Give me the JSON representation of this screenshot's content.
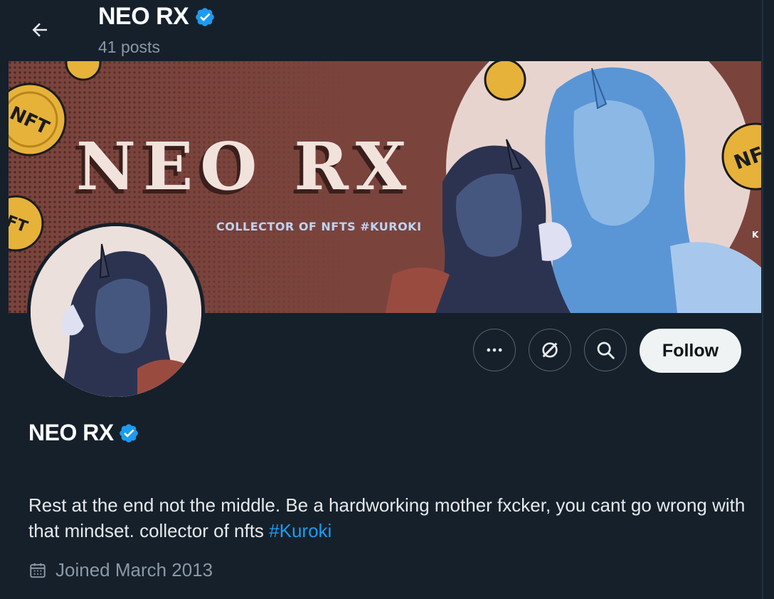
{
  "header": {
    "back_icon": "arrow-left-icon",
    "name": "NEO RX",
    "posts": "41 posts"
  },
  "banner": {
    "title": "NEO RX",
    "subtitle": "COLLECTOR OF NFTS #KUROKI",
    "coin_text": "NFT",
    "coin_text_partial": "FT",
    "coin_text_right": "NF",
    "fan_letter": "K"
  },
  "actions": {
    "more_icon": "more-dots-icon",
    "subscribe_icon": "subscribe-slash-icon",
    "search_icon": "search-icon",
    "follow_label": "Follow"
  },
  "profile": {
    "name": "NEO RX",
    "bio_text": "Rest at the end not the middle. Be a hardworking mother fxcker, you cant go wrong with that mindset. collector of nfts ",
    "bio_hashtag": "#Kuroki",
    "joined": "Joined March 2013",
    "joined_icon": "calendar-icon"
  },
  "colors": {
    "background": "#15202b",
    "accent": "#1d9bf0",
    "muted": "#8b98a5",
    "banner_brown": "#7a443d",
    "follow_bg": "#eff3f4"
  }
}
